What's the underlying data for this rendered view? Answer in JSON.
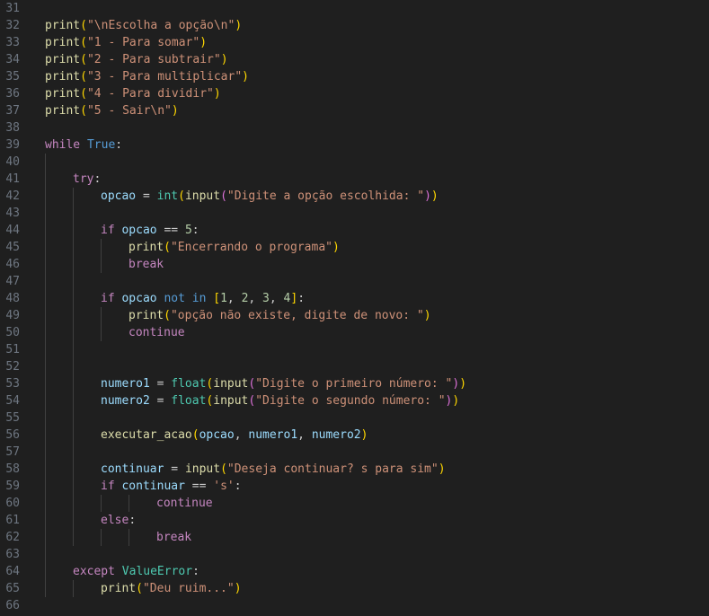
{
  "editor": {
    "lines": [
      {
        "n": "31",
        "indent": 0,
        "guides": 0,
        "tokens": []
      },
      {
        "n": "32",
        "indent": 0,
        "guides": 0,
        "tokens": [
          [
            "fn",
            "print"
          ],
          [
            "p1",
            "("
          ],
          [
            "str",
            "\"\\nEscolha a opção\\n\""
          ],
          [
            "p1",
            ")"
          ]
        ]
      },
      {
        "n": "33",
        "indent": 0,
        "guides": 0,
        "tokens": [
          [
            "fn",
            "print"
          ],
          [
            "p1",
            "("
          ],
          [
            "str",
            "\"1 - Para somar\""
          ],
          [
            "p1",
            ")"
          ]
        ]
      },
      {
        "n": "34",
        "indent": 0,
        "guides": 0,
        "tokens": [
          [
            "fn",
            "print"
          ],
          [
            "p1",
            "("
          ],
          [
            "str",
            "\"2 - Para subtrair\""
          ],
          [
            "p1",
            ")"
          ]
        ]
      },
      {
        "n": "35",
        "indent": 0,
        "guides": 0,
        "tokens": [
          [
            "fn",
            "print"
          ],
          [
            "p1",
            "("
          ],
          [
            "str",
            "\"3 - Para multiplicar\""
          ],
          [
            "p1",
            ")"
          ]
        ]
      },
      {
        "n": "36",
        "indent": 0,
        "guides": 0,
        "tokens": [
          [
            "fn",
            "print"
          ],
          [
            "p1",
            "("
          ],
          [
            "str",
            "\"4 - Para dividir\""
          ],
          [
            "p1",
            ")"
          ]
        ]
      },
      {
        "n": "37",
        "indent": 0,
        "guides": 0,
        "tokens": [
          [
            "fn",
            "print"
          ],
          [
            "p1",
            "("
          ],
          [
            "str",
            "\"5 - Sair\\n\""
          ],
          [
            "p1",
            ")"
          ]
        ]
      },
      {
        "n": "38",
        "indent": 0,
        "guides": 0,
        "tokens": []
      },
      {
        "n": "39",
        "indent": 0,
        "guides": 0,
        "tokens": [
          [
            "kw",
            "while"
          ],
          [
            "pl",
            " "
          ],
          [
            "const",
            "True"
          ],
          [
            "pl",
            ":"
          ]
        ]
      },
      {
        "n": "40",
        "indent": 0,
        "guides": 1,
        "tokens": []
      },
      {
        "n": "41",
        "indent": 1,
        "guides": 1,
        "tokens": [
          [
            "kw",
            "try"
          ],
          [
            "pl",
            ":"
          ]
        ]
      },
      {
        "n": "42",
        "indent": 2,
        "guides": 2,
        "tokens": [
          [
            "var",
            "opcao"
          ],
          [
            "pl",
            " = "
          ],
          [
            "cls",
            "int"
          ],
          [
            "p1",
            "("
          ],
          [
            "fn",
            "input"
          ],
          [
            "p2",
            "("
          ],
          [
            "str",
            "\"Digite a opção escolhida: \""
          ],
          [
            "p2",
            ")"
          ],
          [
            "p1",
            ")"
          ]
        ]
      },
      {
        "n": "43",
        "indent": 0,
        "guides": 2,
        "tokens": []
      },
      {
        "n": "44",
        "indent": 2,
        "guides": 2,
        "tokens": [
          [
            "kw",
            "if"
          ],
          [
            "pl",
            " "
          ],
          [
            "var",
            "opcao"
          ],
          [
            "pl",
            " == "
          ],
          [
            "num",
            "5"
          ],
          [
            "pl",
            ":"
          ]
        ]
      },
      {
        "n": "45",
        "indent": 3,
        "guides": 3,
        "tokens": [
          [
            "fn",
            "print"
          ],
          [
            "p1",
            "("
          ],
          [
            "str",
            "\"Encerrando o programa\""
          ],
          [
            "p1",
            ")"
          ]
        ]
      },
      {
        "n": "46",
        "indent": 3,
        "guides": 3,
        "tokens": [
          [
            "kw",
            "break"
          ]
        ]
      },
      {
        "n": "47",
        "indent": 0,
        "guides": 2,
        "tokens": []
      },
      {
        "n": "48",
        "indent": 2,
        "guides": 2,
        "tokens": [
          [
            "kw",
            "if"
          ],
          [
            "pl",
            " "
          ],
          [
            "var",
            "opcao"
          ],
          [
            "pl",
            " "
          ],
          [
            "const",
            "not in"
          ],
          [
            "pl",
            " "
          ],
          [
            "p1",
            "["
          ],
          [
            "num",
            "1"
          ],
          [
            "pl",
            ", "
          ],
          [
            "num",
            "2"
          ],
          [
            "pl",
            ", "
          ],
          [
            "num",
            "3"
          ],
          [
            "pl",
            ", "
          ],
          [
            "num",
            "4"
          ],
          [
            "p1",
            "]"
          ],
          [
            "pl",
            ":"
          ]
        ]
      },
      {
        "n": "49",
        "indent": 3,
        "guides": 3,
        "tokens": [
          [
            "fn",
            "print"
          ],
          [
            "p1",
            "("
          ],
          [
            "str",
            "\"opção não existe, digite de novo: \""
          ],
          [
            "p1",
            ")"
          ]
        ]
      },
      {
        "n": "50",
        "indent": 3,
        "guides": 3,
        "tokens": [
          [
            "kw",
            "continue"
          ]
        ]
      },
      {
        "n": "51",
        "indent": 0,
        "guides": 2,
        "tokens": []
      },
      {
        "n": "52",
        "indent": 0,
        "guides": 2,
        "tokens": []
      },
      {
        "n": "53",
        "indent": 2,
        "guides": 2,
        "tokens": [
          [
            "var",
            "numero1"
          ],
          [
            "pl",
            " = "
          ],
          [
            "cls",
            "float"
          ],
          [
            "p1",
            "("
          ],
          [
            "fn",
            "input"
          ],
          [
            "p2",
            "("
          ],
          [
            "str",
            "\"Digite o primeiro número: \""
          ],
          [
            "p2",
            ")"
          ],
          [
            "p1",
            ")"
          ]
        ]
      },
      {
        "n": "54",
        "indent": 2,
        "guides": 2,
        "tokens": [
          [
            "var",
            "numero2"
          ],
          [
            "pl",
            " = "
          ],
          [
            "cls",
            "float"
          ],
          [
            "p1",
            "("
          ],
          [
            "fn",
            "input"
          ],
          [
            "p2",
            "("
          ],
          [
            "str",
            "\"Digite o segundo número: \""
          ],
          [
            "p2",
            ")"
          ],
          [
            "p1",
            ")"
          ]
        ]
      },
      {
        "n": "55",
        "indent": 0,
        "guides": 2,
        "tokens": []
      },
      {
        "n": "56",
        "indent": 2,
        "guides": 2,
        "tokens": [
          [
            "fn",
            "executar_acao"
          ],
          [
            "p1",
            "("
          ],
          [
            "var",
            "opcao"
          ],
          [
            "pl",
            ", "
          ],
          [
            "var",
            "numero1"
          ],
          [
            "pl",
            ", "
          ],
          [
            "var",
            "numero2"
          ],
          [
            "p1",
            ")"
          ]
        ]
      },
      {
        "n": "57",
        "indent": 0,
        "guides": 2,
        "tokens": []
      },
      {
        "n": "58",
        "indent": 2,
        "guides": 2,
        "tokens": [
          [
            "var",
            "continuar"
          ],
          [
            "pl",
            " = "
          ],
          [
            "fn",
            "input"
          ],
          [
            "p1",
            "("
          ],
          [
            "str",
            "\"Deseja continuar? s para sim\""
          ],
          [
            "p1",
            ")"
          ]
        ]
      },
      {
        "n": "59",
        "indent": 2,
        "guides": 2,
        "tokens": [
          [
            "kw",
            "if"
          ],
          [
            "pl",
            " "
          ],
          [
            "var",
            "continuar"
          ],
          [
            "pl",
            " == "
          ],
          [
            "str",
            "'s'"
          ],
          [
            "pl",
            ":"
          ]
        ]
      },
      {
        "n": "60",
        "indent": 4,
        "guides": 4,
        "tokens": [
          [
            "kw",
            "continue"
          ]
        ]
      },
      {
        "n": "61",
        "indent": 2,
        "guides": 2,
        "tokens": [
          [
            "kw",
            "else"
          ],
          [
            "pl",
            ":"
          ]
        ]
      },
      {
        "n": "62",
        "indent": 4,
        "guides": 4,
        "tokens": [
          [
            "kw",
            "break"
          ]
        ]
      },
      {
        "n": "63",
        "indent": 0,
        "guides": 1,
        "tokens": []
      },
      {
        "n": "64",
        "indent": 1,
        "guides": 1,
        "tokens": [
          [
            "kw",
            "except"
          ],
          [
            "pl",
            " "
          ],
          [
            "cls",
            "ValueError"
          ],
          [
            "pl",
            ":"
          ]
        ]
      },
      {
        "n": "65",
        "indent": 2,
        "guides": 2,
        "tokens": [
          [
            "fn",
            "print"
          ],
          [
            "p1",
            "("
          ],
          [
            "str",
            "\"Deu ruim...\""
          ],
          [
            "p1",
            ")"
          ]
        ]
      },
      {
        "n": "66",
        "indent": 0,
        "guides": 0,
        "tokens": []
      }
    ]
  }
}
